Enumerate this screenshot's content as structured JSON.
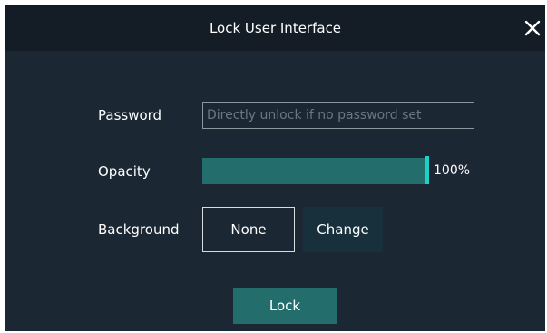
{
  "dialog": {
    "title": "Lock User Interface",
    "close_icon": "close-icon"
  },
  "form": {
    "password_label": "Password",
    "password_placeholder": "Directly unlock if no password set",
    "password_value": "",
    "opacity_label": "Opacity",
    "opacity_percent": 100,
    "opacity_value_text": "100%",
    "background_label": "Background",
    "background_selected": "None",
    "background_change_label": "Change"
  },
  "actions": {
    "lock_label": "Lock"
  },
  "colors": {
    "dialog_bg": "#1b2733",
    "titlebar_bg": "#141d26",
    "accent": "#236d6d",
    "slider_handle": "#1fd0c8"
  }
}
